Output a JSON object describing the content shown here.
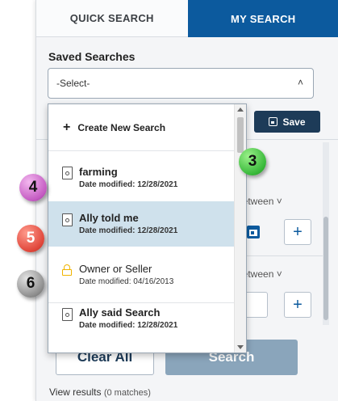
{
  "tabs": {
    "quick": "QUICK SEARCH",
    "my": "MY SEARCH"
  },
  "saved_searches": {
    "label": "Saved Searches",
    "select_value": "-Select-",
    "save_label": "Save"
  },
  "dropdown": {
    "create_label": "Create New Search",
    "items": [
      {
        "name": "farming",
        "date": "Date modified: 12/28/2021",
        "icon": "saved-search-icon"
      },
      {
        "name": "Ally told me",
        "date": "Date modified: 12/28/2021",
        "icon": "saved-search-icon",
        "selected": true
      },
      {
        "name": "Owner or Seller",
        "date": "Date modified: 04/16/2013",
        "icon": "lock-icon"
      },
      {
        "name": "Ally said Search",
        "date": "Date modified: 12/28/2021",
        "icon": "saved-search-icon"
      }
    ]
  },
  "criteria": {
    "between_1": "between",
    "between_2": "between",
    "plus": "+"
  },
  "buttons": {
    "clear": "Clear All",
    "search": "Search"
  },
  "results": {
    "label": "View results",
    "count": "(0 matches)"
  },
  "callouts": [
    "3",
    "4",
    "5",
    "6"
  ],
  "colors": {
    "accent": "#0c5a9e",
    "save_button": "#1d3b58",
    "selected_row": "#cfe1ec",
    "lock": "#f0b400"
  }
}
